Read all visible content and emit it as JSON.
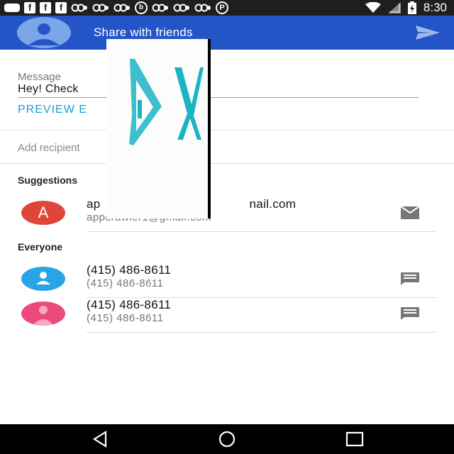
{
  "status_bar": {
    "time": "8:30",
    "left_icons": [
      "chat-bubble-icon",
      "facebook-icon",
      "facebook-icon",
      "facebook-icon",
      "chain-icon",
      "chain-icon",
      "chain-icon",
      "beats-icon",
      "chain-icon",
      "chain-icon",
      "chain-icon",
      "pinterest-icon"
    ],
    "f_glyph": "f",
    "b_glyph": "b",
    "p_glyph": "P",
    "right_icons": [
      "wifi-icon",
      "signal-icon",
      "battery-charging-icon"
    ]
  },
  "app_bar": {
    "title": "Share with friends",
    "color": "#2354c8",
    "send_icon": "send-icon",
    "avatar_icon": "account-avatar-icon"
  },
  "message": {
    "label": "Message",
    "value": "Hey! Check",
    "preview_link": "PREVIEW E"
  },
  "recipient": {
    "placeholder": "Add recipient"
  },
  "suggestions": {
    "header": "Suggestions",
    "items": [
      {
        "initial": "A",
        "name_start": "ap",
        "name_end": "nail.com",
        "sub": "appcrawler1@gmail.com",
        "action_icon": "email-icon",
        "avatar_color": "#e0453a"
      }
    ]
  },
  "everyone": {
    "header": "Everyone",
    "items": [
      {
        "name": "(415) 486-8611",
        "sub": "(415) 486-8611",
        "action_icon": "message-icon",
        "avatar_color": "#29a4e6"
      },
      {
        "name": "(415) 486-8611",
        "sub": "(415) 486-8611",
        "action_icon": "message-icon",
        "avatar_color": "#ea4a7c"
      }
    ]
  },
  "overlay": {
    "accent_color": "#1bb4c4",
    "close_icon": "close-icon",
    "play_icon": "play-icon"
  },
  "nav_bar": {
    "buttons": [
      "back-icon",
      "home-icon",
      "recents-icon"
    ]
  }
}
